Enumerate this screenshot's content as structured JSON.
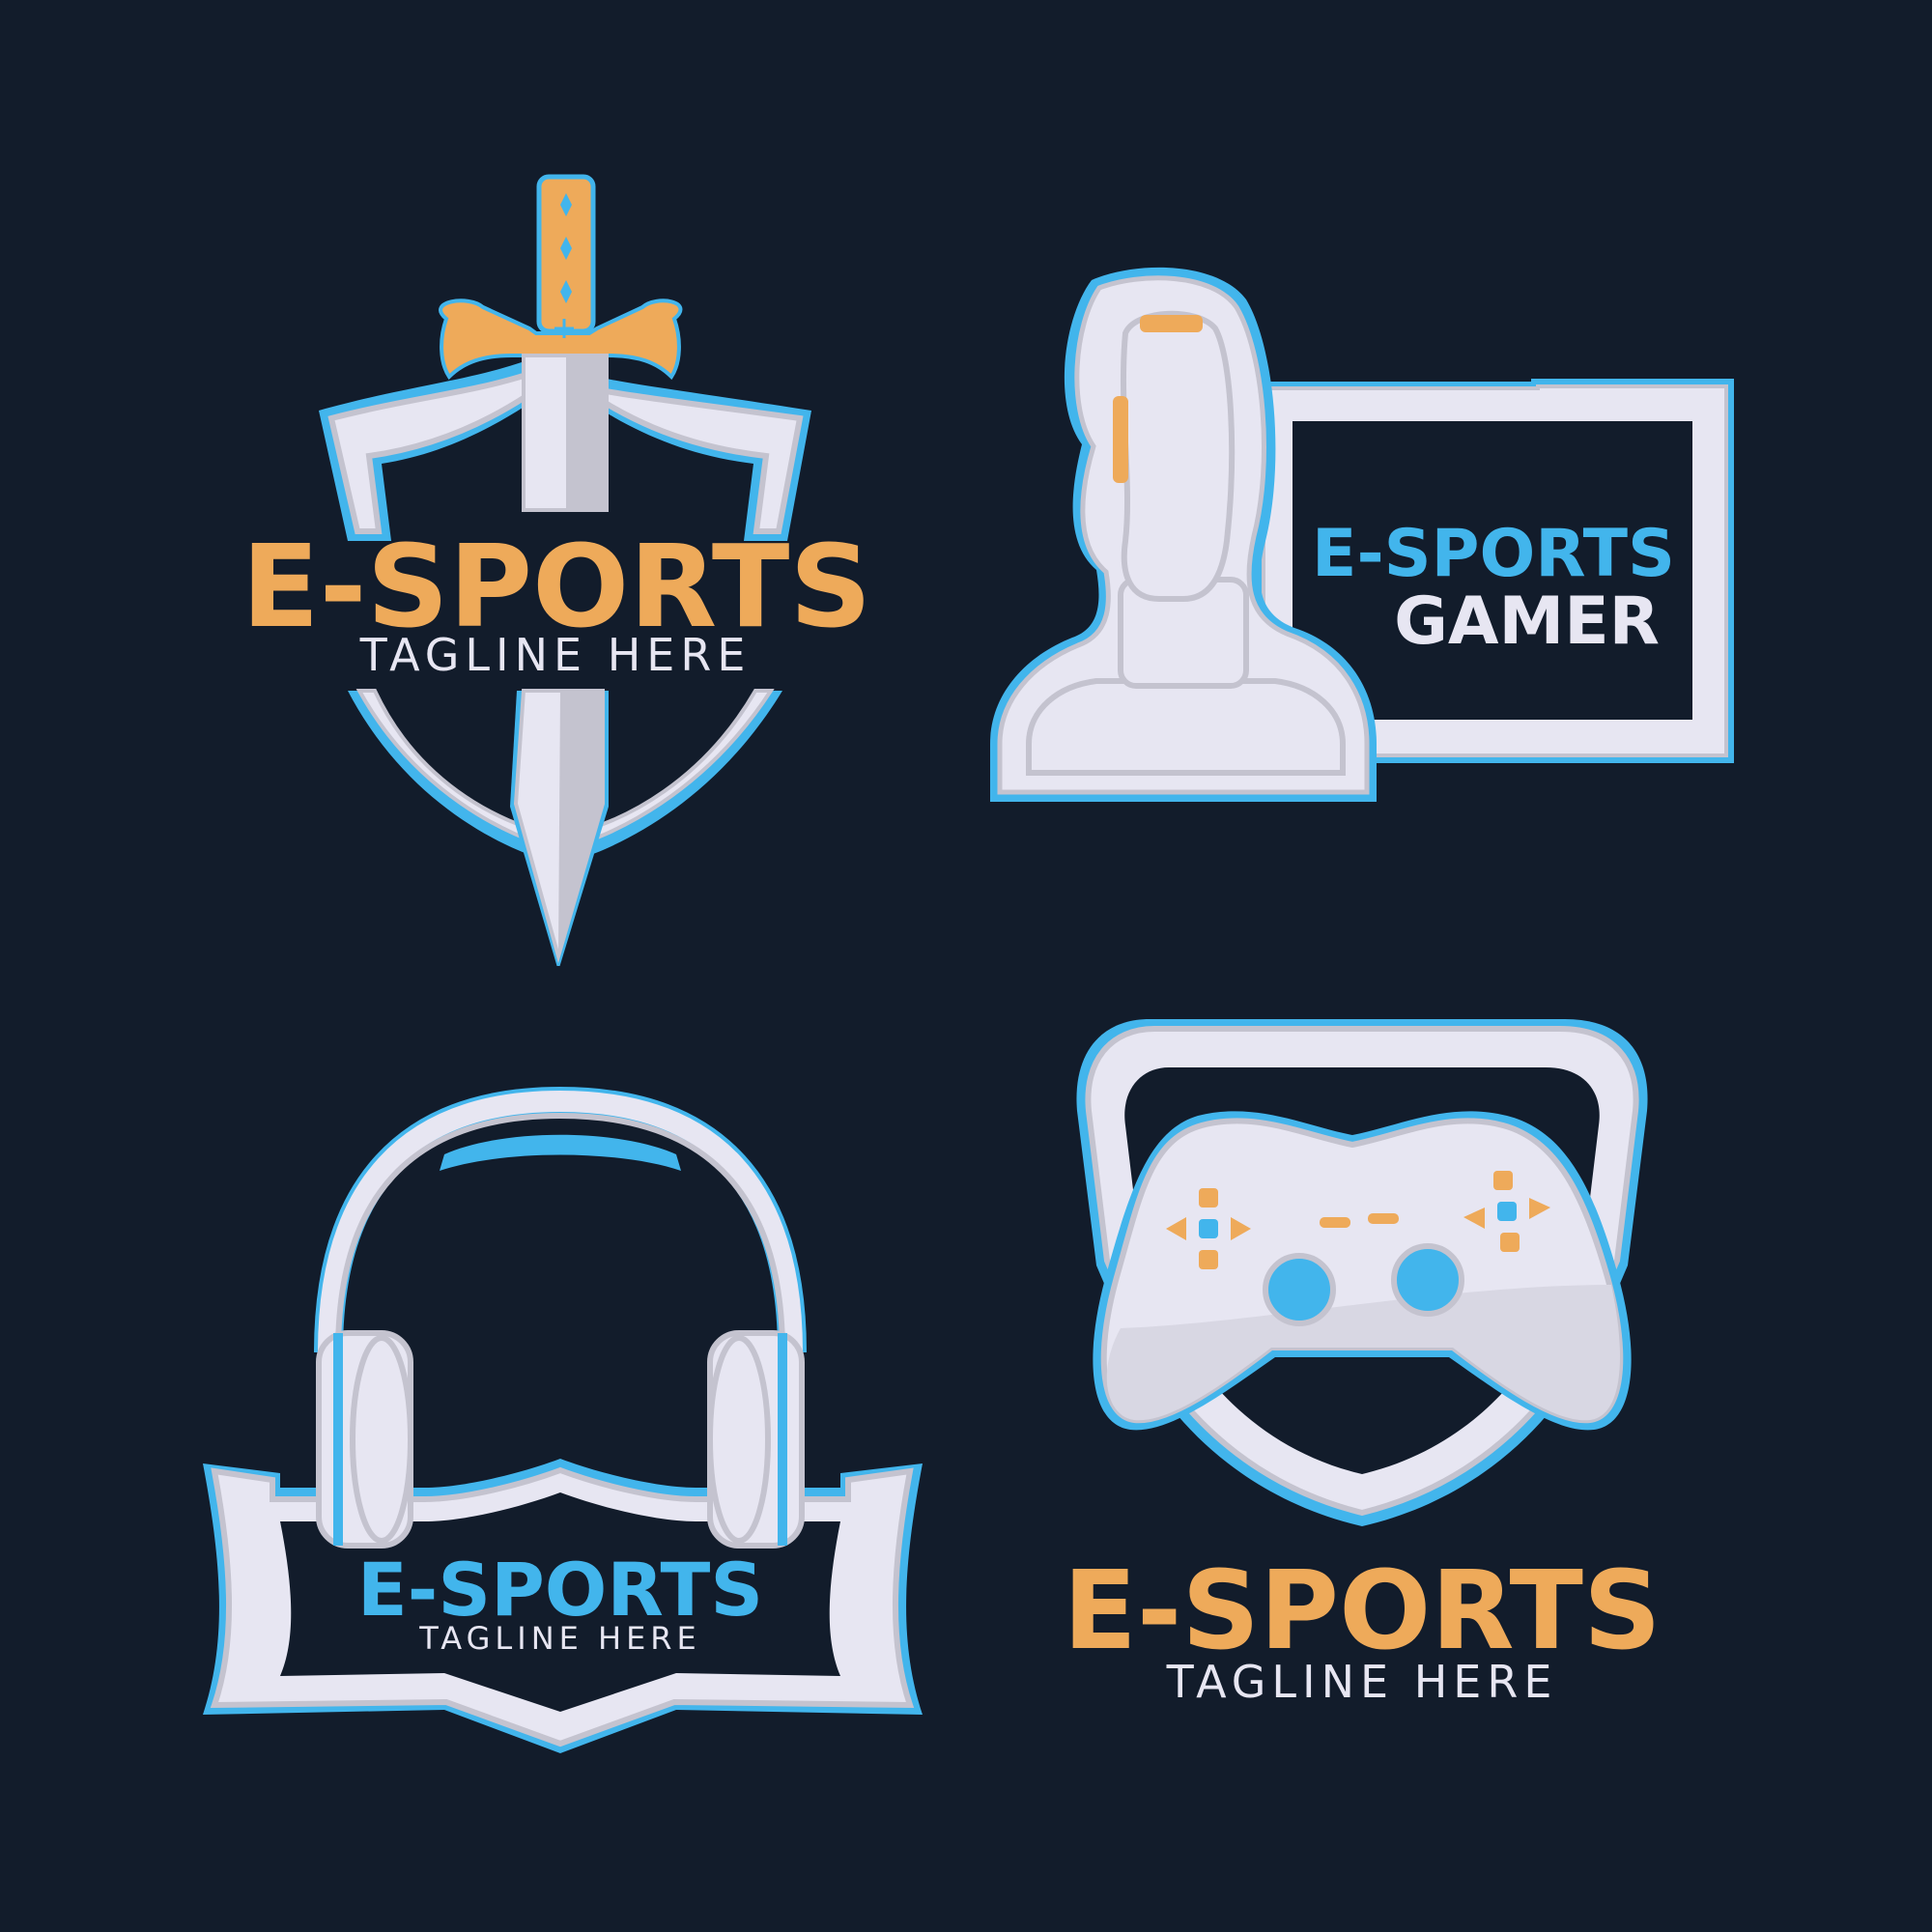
{
  "colors": {
    "background": "#121c2b",
    "accent_orange": "#eeaa5a",
    "accent_blue": "#42b5ec",
    "silver": "#e7e6f2",
    "silver_shade": "#c4c3cf",
    "tagline": "#e7e6f2"
  },
  "logos": [
    {
      "icon": "sword-shield-icon",
      "title": "E-SPORTS",
      "tagline": "TAGLINE HERE"
    },
    {
      "icon": "joystick-icon",
      "title": "E-SPORTS",
      "subtitle": "GAMER"
    },
    {
      "icon": "headphones-icon",
      "title": "E-SPORTS",
      "tagline": "TAGLINE HERE"
    },
    {
      "icon": "gamepad-icon",
      "title": "E-SPORTS",
      "tagline": "TAGLINE HERE"
    }
  ]
}
